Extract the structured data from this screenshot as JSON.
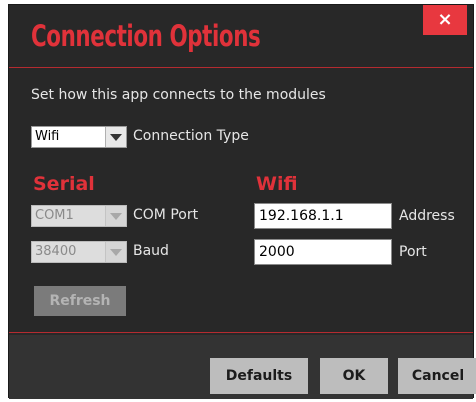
{
  "dialog": {
    "title": "Connection Options",
    "close_label": "×",
    "description": "Set how this app connects to the modules"
  },
  "connection_type": {
    "value": "Wifi",
    "label": "Connection Type"
  },
  "serial": {
    "heading": "Serial",
    "port_value": "COM1",
    "port_label": "COM Port",
    "baud_value": "38400",
    "baud_label": "Baud",
    "refresh_label": "Refresh"
  },
  "wifi": {
    "heading": "Wifi",
    "address_value": "192.168.1.1",
    "address_label": "Address",
    "port_value": "2000",
    "port_label": "Port"
  },
  "buttons": {
    "defaults_label": "Defaults",
    "ok_label": "OK",
    "cancel_label": "Cancel"
  },
  "colors": {
    "accent": "#e0323a",
    "background": "#282828",
    "button": "#bdbdbd"
  }
}
